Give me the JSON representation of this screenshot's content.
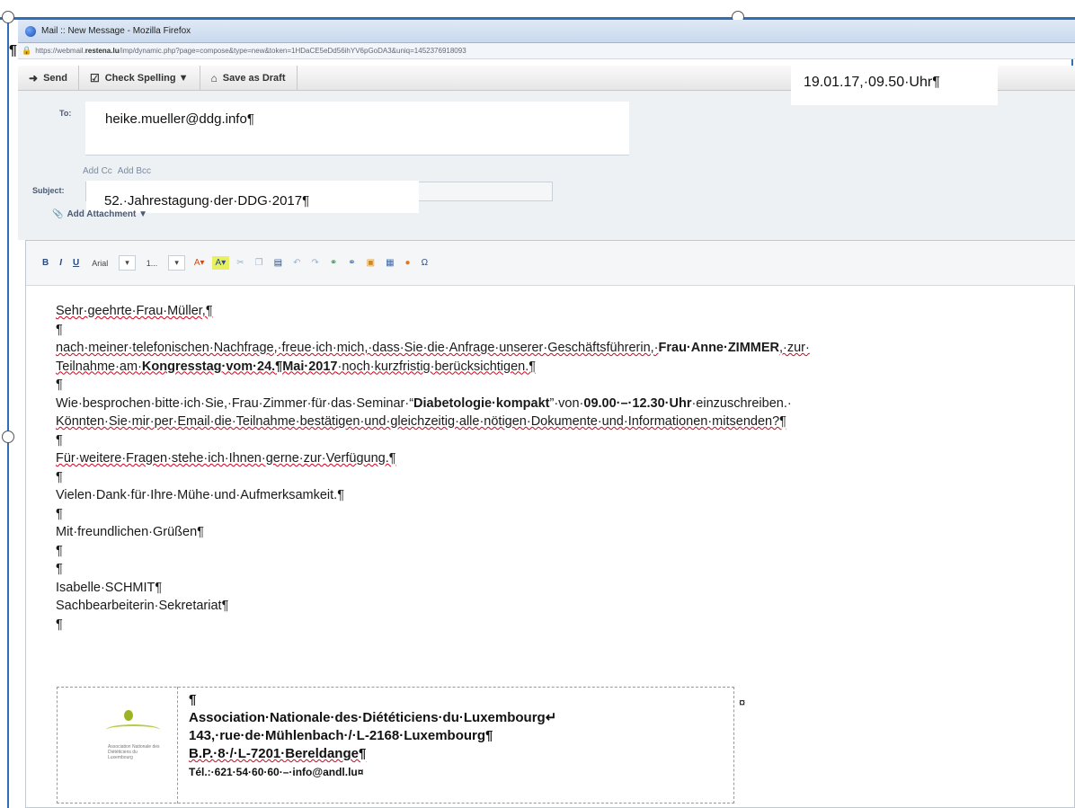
{
  "window": {
    "title": "Mail :: New Message - Mozilla Firefox",
    "url_prefix": "https://webmail.",
    "url_domain": "restena.lu",
    "url_rest": "/imp/dynamic.php?page=compose&type=new&token=1HDaCE5eDd56ihYV6pGoDA3&uniq=1452376918093"
  },
  "toolbar": {
    "send_label": "Send",
    "spell_label": "Check Spelling ▼",
    "draft_label": "Save as Draft"
  },
  "stamp": "19.01.17,·09.50·Uhr¶",
  "compose": {
    "to_label": "To:",
    "to_value": "heike.mueller@ddg.info¶",
    "add_cc": "Add Cc",
    "add_bcc": "Add Bcc",
    "subject_label": "Subject:",
    "subject_value": "52.·Jahrestagung·der·DDG·2017¶",
    "attach_label": "Add Attachment ▼"
  },
  "format_bar": {
    "bold": "B",
    "italic": "I",
    "underline": "U",
    "font": "Arial",
    "size": "1..."
  },
  "body": {
    "l1": "Sehr·geehrte·Frau·Müller,¶",
    "l2": "¶",
    "l3a": "nach·meiner·telefonischen·Nachfrage,·freue·ich·mich,·dass·Sie·die·Anfrage·unserer·Geschäftsführerin,·",
    "l3b": "Frau·Anne·ZIMMER",
    "l3c": ",·zur·",
    "l4a": "Teilnahme·am·",
    "l4b": "Kongresstag·vom·24.¶Mai·2017",
    "l4c": "·noch·kurzfristig·berücksichtigen.¶",
    "l5": "¶",
    "l6a": "Wie·besprochen·bitte·ich·Sie,·Frau·Zimmer·für·das·Seminar·“",
    "l6b": "Diabetologie·kompakt",
    "l6c": "”·von·",
    "l6d": "09.00·–·12.30·Uhr",
    "l6e": "·einzuschreiben.·",
    "l7": "Könnten·Sie·mir·per·Email·die·Teilnahme·bestätigen·und·gleichzeitig·alle·nötigen·Dokumente·und·Informationen·mitsenden?¶",
    "l8": "¶",
    "l9": "Für·weitere·Fragen·stehe·ich·Ihnen·gerne·zur·Verfügung.¶",
    "l10": "¶",
    "l11": "Vielen·Dank·für·Ihre·Mühe·und·Aufmerksamkeit.¶",
    "l12": "¶",
    "l13": "Mit·freundlichen·Grüßen¶",
    "l14": "¶",
    "l15": "¶",
    "l16": "Isabelle·SCHMIT¶",
    "l17": "Sachbearbeiterin·Sekretariat¶",
    "l18": "¶"
  },
  "signature": {
    "pilcrow": "¶",
    "org": "Association·Nationale·des·Diététiciens·du·Luxembourg↵",
    "address": "143,·rue·de·Mühlenbach·/·L-2168·Luxembourg¶",
    "po_box": "B.P.·8·/·L-7201·Bereldange¶",
    "contact": "Tél.:·621·54·60·60·–·info@andl.lu¤",
    "cell_end": "¤",
    "logo_text": "Association Nationale des Diététiciens du Luxembourg"
  },
  "colors": {
    "accent": "#2e6fb8",
    "spell_error": "#d0021b",
    "logo_green": "#9ab422"
  }
}
